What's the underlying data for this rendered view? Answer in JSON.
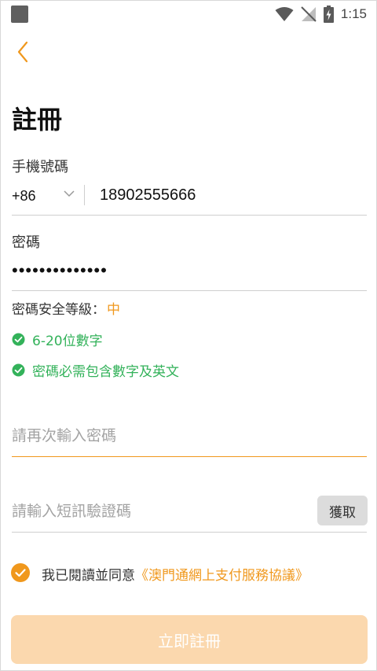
{
  "status_bar": {
    "time": "1:15"
  },
  "header": {
    "title": "註冊"
  },
  "phone": {
    "label": "手機號碼",
    "country_code": "+86",
    "value": "18902555666"
  },
  "password": {
    "label": "密碼",
    "value": "••••••••••••••"
  },
  "strength": {
    "label": "密碼安全等級：",
    "value": "中"
  },
  "rules": [
    {
      "text": "6-20位數字"
    },
    {
      "text": "密碼必需包含數字及英文"
    }
  ],
  "confirm_password": {
    "placeholder": "請再次輸入密碼"
  },
  "sms_code": {
    "placeholder": "請輸入短訊驗證碼",
    "button_label": "獲取"
  },
  "agreement": {
    "text": "我已閱讀並同意",
    "link": "《澳門通網上支付服務協議》",
    "checked": true
  },
  "submit": {
    "label": "立即註冊"
  },
  "colors": {
    "accent": "#f0981d",
    "success": "#33b25a",
    "submit_disabled": "#fbd8ae"
  }
}
